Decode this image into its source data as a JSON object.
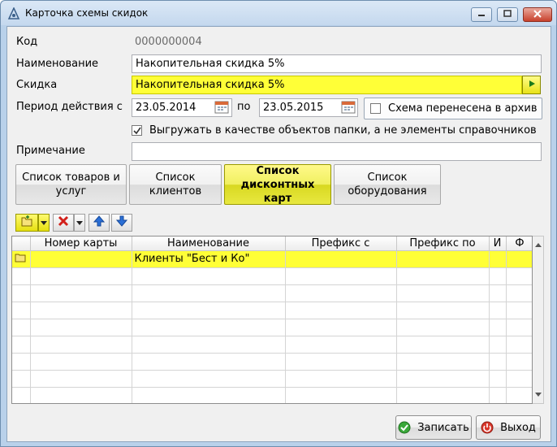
{
  "window": {
    "title": "Карточка схемы скидок",
    "icons": {
      "app": "discount-scheme-icon",
      "minimize": "minimize-icon",
      "maximize": "maximize-icon",
      "close": "close-icon"
    }
  },
  "form": {
    "code_label": "Код",
    "code_value": "0000000004",
    "name_label": "Наименование",
    "name_value": "Накопительная скидка 5%",
    "discount_label": "Скидка",
    "discount_value": "Накопительная скидка 5%",
    "period_label": "Период действия с",
    "period_from": "23.05.2014",
    "period_to_label": "по",
    "period_to": "23.05.2015",
    "archive_label": "Схема перенесена в архив",
    "archive_checked": false,
    "export_label": "Выгружать в качестве объектов папки, а не элементы справочников",
    "export_checked": true,
    "note_label": "Примечание",
    "note_value": ""
  },
  "tabs": [
    {
      "line1": "Список товаров и",
      "line2": "услуг",
      "active": false
    },
    {
      "line1": "Список",
      "line2": "клиентов",
      "active": false
    },
    {
      "line1": "Список",
      "line2": "дисконтных карт",
      "active": true
    },
    {
      "line1": "Список",
      "line2": "оборудования",
      "active": false
    }
  ],
  "toolbar": {
    "icons": [
      "add-folder-icon",
      "dropdown-arrow-icon",
      "delete-icon",
      "dropdown-arrow-icon",
      "move-up-icon",
      "move-down-icon"
    ]
  },
  "table": {
    "columns": [
      "",
      "Номер карты",
      "Наименование",
      "Префикс с",
      "Префикс по",
      "И",
      "Ф"
    ],
    "rows": [
      {
        "selected": true,
        "is_folder": true,
        "card_number": "",
        "name": "Клиенты \"Бест и Ко\"",
        "prefix_from": "",
        "prefix_to": "",
        "i": "",
        "f": ""
      }
    ]
  },
  "footer": {
    "save_label": "Записать",
    "exit_label": "Выход"
  },
  "colors": {
    "highlight": "#ffff37",
    "window_frame": "#b9d1ea",
    "close_button": "#c8412c"
  }
}
